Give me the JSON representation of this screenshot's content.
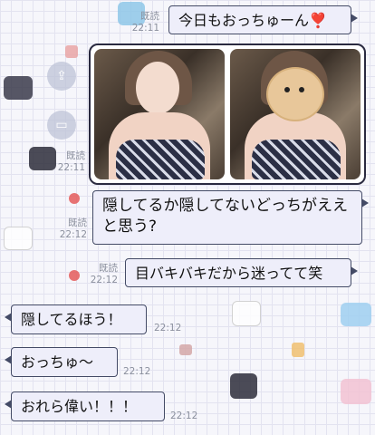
{
  "messages": {
    "m1": {
      "text": "今日もおっちゅーん❣️",
      "read": "既読",
      "time": "22:11"
    },
    "m2": {
      "read": "既読",
      "time": "22:11"
    },
    "m3": {
      "text": "隠してるか隠してないどっちがええと思う?",
      "read": "既読",
      "time": "22:12"
    },
    "m4": {
      "text": "目バキバキだから迷ってて笑",
      "read": "既読",
      "time": "22:12"
    },
    "r1": {
      "text": "隠してるほう！",
      "time": "22:12"
    },
    "r2": {
      "text": "おっちゅ〜",
      "time": "22:12"
    },
    "r3": {
      "text": "おれら偉い！！！",
      "time": "22:12"
    }
  },
  "icons": {
    "share": "share-icon",
    "save": "save-icon"
  },
  "colors": {
    "bubble_border": "#444b66",
    "bubble_fill": "#eeeefa",
    "meta_text": "#8a8f9d"
  }
}
